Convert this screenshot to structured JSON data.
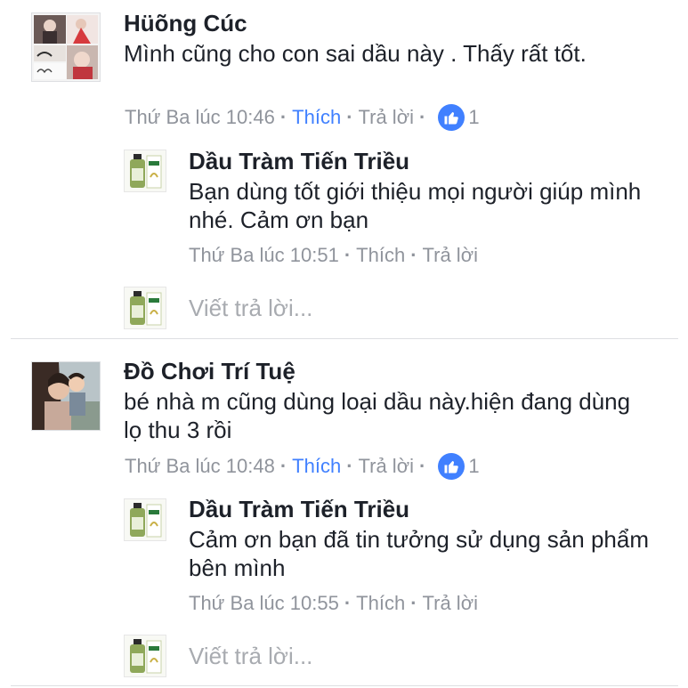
{
  "threads": [
    {
      "comment": {
        "author": "Hüõng Cúc",
        "text": "Mình  cũng  cho con sai dầu  này .  Thấy  rất tốt.",
        "time": "Thứ Ba lúc 10:46",
        "like_label": "Thích",
        "reply_label": "Trả lời",
        "like_count": "1"
      },
      "reply": {
        "author": "Dầu Tràm Tiến Triều",
        "text": "Bạn dùng tốt giới thiệu mọi người giúp mình nhé. Cảm ơn bạn",
        "time": "Thứ Ba lúc 10:51",
        "like_label": "Thích",
        "reply_label": "Trả lời"
      },
      "reply_placeholder": "Viết trả lời..."
    },
    {
      "comment": {
        "author": "Đồ Chơi Trí Tuệ",
        "text": "bé nhà m cũng dùng loại dầu này.hiện đang dùng lọ thu 3 rồi",
        "time": "Thứ Ba lúc 10:48",
        "like_label": "Thích",
        "reply_label": "Trả lời",
        "like_count": "1"
      },
      "reply": {
        "author": "Dầu Tràm Tiến Triều",
        "text": "Cảm ơn bạn đã tin tưởng sử dụng sản phẩm bên mình",
        "time": "Thứ Ba lúc 10:55",
        "like_label": "Thích",
        "reply_label": "Trả lời"
      },
      "reply_placeholder": "Viết trả lời..."
    }
  ],
  "colors": {
    "link_blue": "#4080ff",
    "meta_gray": "#90949c",
    "text_dark": "#1d2129",
    "divider": "#dddfe2"
  }
}
